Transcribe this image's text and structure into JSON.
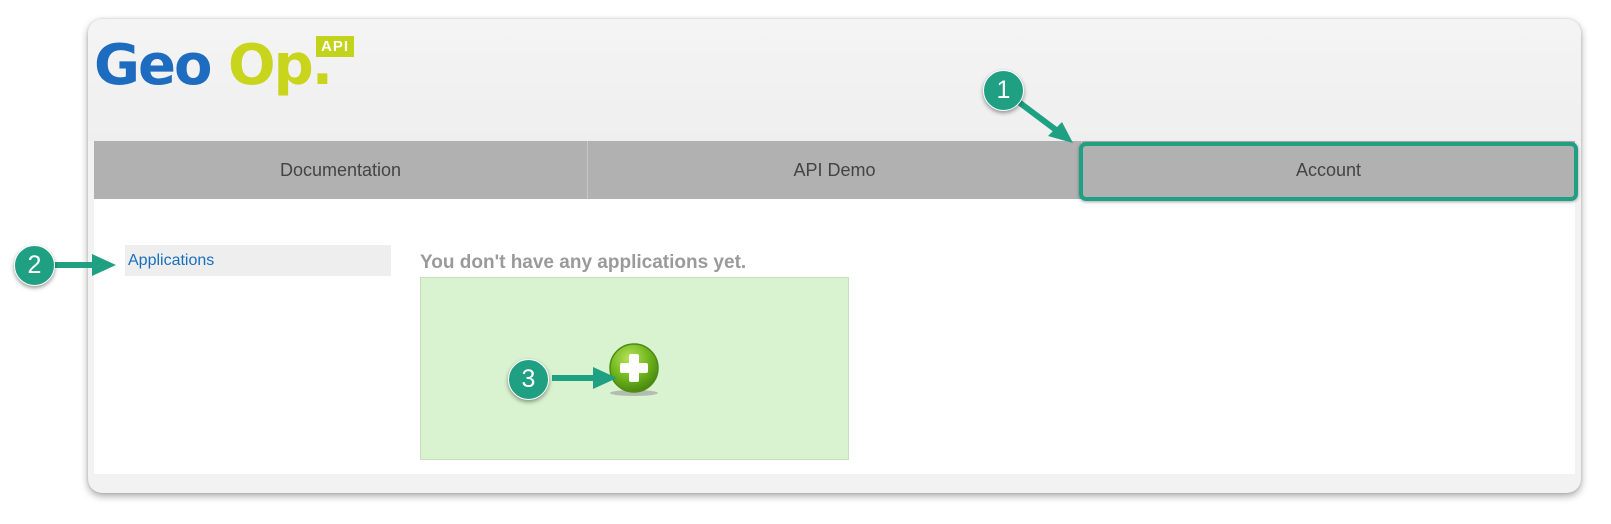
{
  "logo": {
    "geo": "Geo",
    "op": "Op.",
    "badge": "API",
    "colors": {
      "geo": "#1d6cc0",
      "op": "#c9d41c",
      "badge_bg": "#c3d21b"
    }
  },
  "nav": {
    "tabs": [
      {
        "label": "Documentation"
      },
      {
        "label": "API Demo"
      },
      {
        "label": "Account"
      }
    ],
    "background": "#b1b1b1"
  },
  "sidebar": {
    "items": [
      {
        "label": "Applications"
      }
    ]
  },
  "main": {
    "empty_message": "You don't have any applications yet.",
    "add_button_icon": "plus-circle-icon",
    "add_box_color": "#d9f2cf"
  },
  "annotations": {
    "accent_color": "#1fa083",
    "callouts": [
      {
        "number": "1",
        "target": "Account"
      },
      {
        "number": "2",
        "target": "Applications"
      },
      {
        "number": "3",
        "target": "add-button"
      }
    ]
  }
}
